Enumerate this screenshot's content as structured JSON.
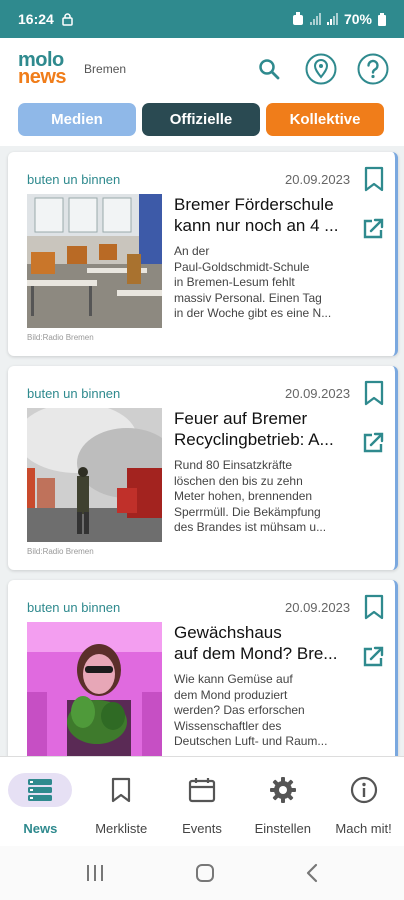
{
  "status": {
    "time": "16:24",
    "battery": "70%"
  },
  "header": {
    "logo_top": "molo",
    "logo_bottom": "news",
    "location": "Bremen",
    "icons": [
      "search-icon",
      "location-pin-icon",
      "help-icon"
    ]
  },
  "filters": [
    {
      "label": "Medien",
      "color": "#8fb8e8"
    },
    {
      "label": "Offizielle",
      "color": "#2a4a52"
    },
    {
      "label": "Kollektive",
      "color": "#f07d1a"
    }
  ],
  "articles": [
    {
      "source": "buten un binnen",
      "date": "20.09.2023",
      "title_lines": [
        "Bremer Förderschule",
        "kann nur noch an 4 ..."
      ],
      "text_lines": [
        "An der",
        "Paul-Goldschmidt-Schule",
        "in Bremen-Lesum fehlt",
        "massiv Personal. Einen Tag",
        "in der Woche gibt es eine N..."
      ],
      "credit": "Bild:Radio Bremen"
    },
    {
      "source": "buten un binnen",
      "date": "20.09.2023",
      "title_lines": [
        "Feuer auf Bremer",
        "Recyclingbetrieb: A..."
      ],
      "text_lines": [
        "Rund 80 Einsatzkräfte",
        "löschen den bis zu zehn",
        "Meter hohen, brennenden",
        "Sperrmüll. Die Bekämpfung",
        "des Brandes ist mühsam u..."
      ],
      "credit": "Bild:Radio Bremen"
    },
    {
      "source": "buten un binnen",
      "date": "20.09.2023",
      "title_lines": [
        "Gewächshaus",
        "auf dem Mond? Bre..."
      ],
      "text_lines": [
        "Wie kann Gemüse auf",
        "dem Mond produziert",
        "werden? Das erforschen",
        "Wissenschaftler des",
        "Deutschen Luft- und Raum..."
      ],
      "credit": ""
    }
  ],
  "nav": {
    "items": [
      {
        "label": "News",
        "icon": "news-list-icon",
        "active": true
      },
      {
        "label": "Merkliste",
        "icon": "bookmark-icon",
        "active": false
      },
      {
        "label": "Events",
        "icon": "calendar-icon",
        "active": false
      },
      {
        "label": "Einstellen",
        "icon": "gear-icon",
        "active": false
      },
      {
        "label": "Mach mit!",
        "icon": "info-icon",
        "active": false
      }
    ]
  },
  "colors": {
    "primary": "#2f8a8e",
    "accent": "#f07d1a"
  }
}
